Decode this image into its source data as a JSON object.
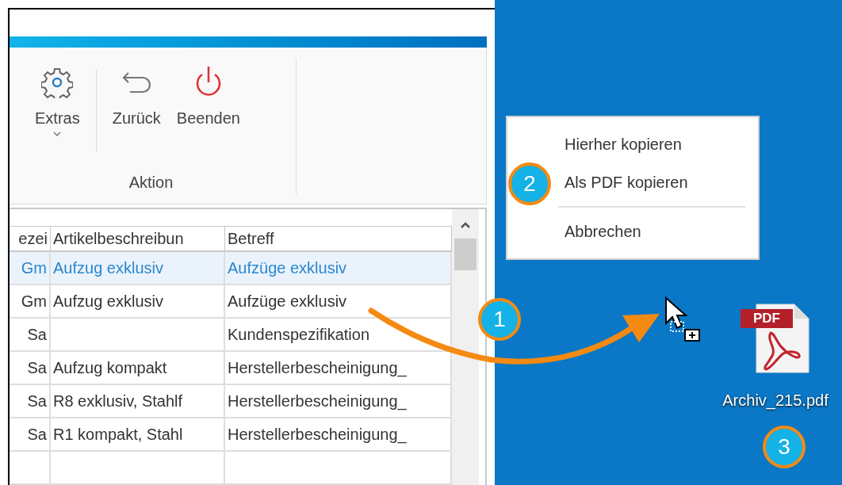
{
  "ribbon": {
    "buttons": [
      {
        "kind": "gear",
        "label": "Extras",
        "dropdown": true
      },
      {
        "kind": "back",
        "label": "Zurück",
        "dropdown": false
      },
      {
        "kind": "power",
        "label": "Beenden",
        "dropdown": false
      }
    ],
    "group_label": "Aktion"
  },
  "table": {
    "columns": [
      "ezei",
      "Artikelbeschreibun",
      "Betreff"
    ],
    "rows": [
      {
        "selected": true,
        "cells": [
          "Gm",
          "Aufzug exklusiv",
          "Aufzüge exklusiv"
        ]
      },
      {
        "selected": false,
        "cells": [
          "Gm",
          "Aufzug exklusiv",
          "Aufzüge exklusiv"
        ]
      },
      {
        "selected": false,
        "cells": [
          "Sa",
          "",
          "Kundenspezifikation"
        ]
      },
      {
        "selected": false,
        "cells": [
          "Sa",
          "Aufzug kompakt",
          "Herstellerbescheinigung_"
        ]
      },
      {
        "selected": false,
        "cells": [
          "Sa",
          "R8 exklusiv, Stahlf",
          "Herstellerbescheinigung_"
        ]
      },
      {
        "selected": false,
        "cells": [
          "Sa",
          "R1 kompakt, Stahl",
          "Herstellerbescheinigung_"
        ]
      },
      {
        "selected": false,
        "cells": [
          "",
          "",
          ""
        ]
      }
    ]
  },
  "context_menu": {
    "items": [
      {
        "kind": "item",
        "label": "Hierher kopieren"
      },
      {
        "kind": "item",
        "label": "Als PDF kopieren"
      },
      {
        "kind": "separator"
      },
      {
        "kind": "item",
        "label": "Abbrechen"
      }
    ]
  },
  "desktop_file": {
    "badge": "PDF",
    "label": "Archiv_215.pdf"
  },
  "step_badges": [
    "1",
    "2",
    "3"
  ]
}
